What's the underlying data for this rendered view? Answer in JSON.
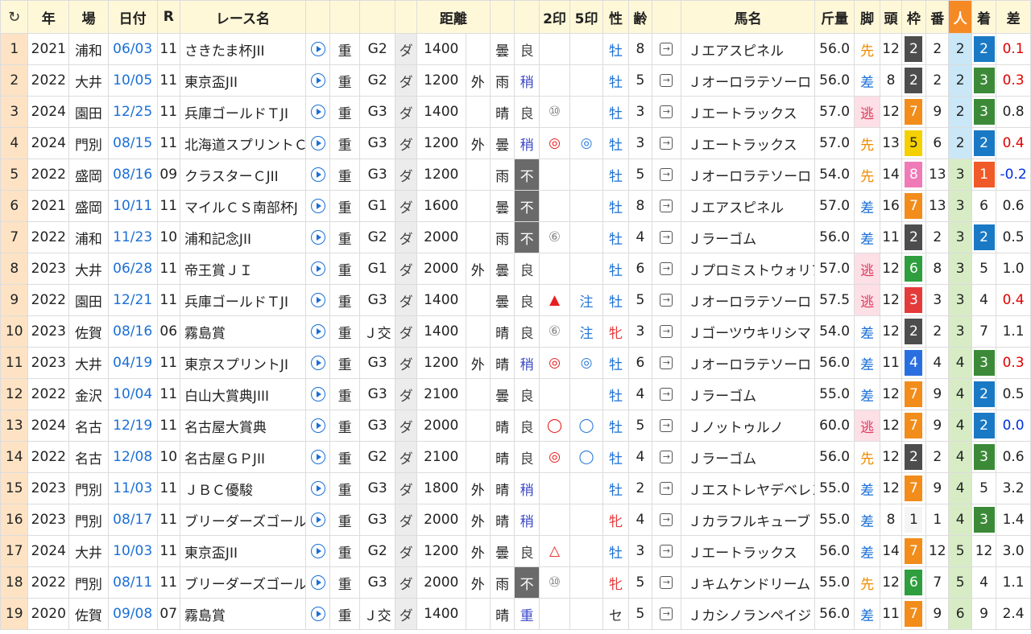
{
  "headers": {
    "refresh": "↻",
    "year": "年",
    "venue": "場",
    "date": "日付",
    "race_no": "R",
    "race": "レース名",
    "grade_blank": "",
    "dist": "距離",
    "m2": "2印",
    "m5": "5印",
    "sex": "性",
    "age": "齢",
    "horse": "馬名",
    "weight": "斤量",
    "style": "脚",
    "heads": "頭",
    "frame": "枠",
    "num": "番",
    "pop": "人",
    "rank": "着",
    "diff": "差"
  },
  "colors": {
    "frame_1": "#f5f5f5",
    "frame_2": "#4d4d4d",
    "frame_3": "#e53a3a",
    "frame_4": "#2a6fe0",
    "frame_5": "#f5d000",
    "frame_6": "#2e9e3e",
    "frame_7": "#f28c1a",
    "frame_8": "#f07ab8",
    "rank_1": "#f05a28",
    "rank_2": "#1a79c4",
    "rank_3": "#3c8a38",
    "pop_bg_low": "#c9e7f6",
    "pop_bg_high": "#d7ecc5"
  },
  "rows": [
    {
      "i": "1",
      "year": "2021",
      "venue": "浦和",
      "date": "06/03",
      "r": "11",
      "race": "さきたま杯JII",
      "track": "重",
      "grade": "G2",
      "surface": "ダ",
      "dist": "1400",
      "io": "",
      "weather": "曇",
      "cond": "良",
      "cond_t": "ok",
      "m2": "",
      "m2_t": "",
      "m5": "",
      "m5_t": "",
      "sex": "牡",
      "sex_t": "m",
      "age": "8",
      "horse": "Ｊエアスピネル",
      "weight": "56.0",
      "style": "先",
      "style_t": "senko",
      "heads": "12",
      "frame": "2",
      "num": "2",
      "pop": "2",
      "rank": "2",
      "diff": "0.1",
      "diff_t": "red"
    },
    {
      "i": "2",
      "year": "2022",
      "venue": "大井",
      "date": "10/05",
      "r": "11",
      "race": "東京盃JII",
      "track": "重",
      "grade": "G2",
      "surface": "ダ",
      "dist": "1200",
      "io": "外",
      "weather": "雨",
      "cond": "稍",
      "cond_t": "mid",
      "m2": "",
      "m2_t": "",
      "m5": "",
      "m5_t": "",
      "sex": "牡",
      "sex_t": "m",
      "age": "5",
      "horse": "Ｊオーロラテソーロ",
      "weight": "56.0",
      "style": "差",
      "style_t": "sashi",
      "heads": "8",
      "frame": "2",
      "num": "2",
      "pop": "2",
      "rank": "3",
      "diff": "0.3",
      "diff_t": "red"
    },
    {
      "i": "3",
      "year": "2024",
      "venue": "園田",
      "date": "12/25",
      "r": "11",
      "race": "兵庫ゴールドＴJI",
      "track": "重",
      "grade": "G3",
      "surface": "ダ",
      "dist": "1400",
      "io": "",
      "weather": "晴",
      "cond": "良",
      "cond_t": "ok",
      "m2": "⑩",
      "m2_t": "grey",
      "m5": "",
      "m5_t": "",
      "sex": "牡",
      "sex_t": "m",
      "age": "3",
      "horse": "Ｊエートラックス",
      "weight": "57.0",
      "style": "逃",
      "style_t": "nige",
      "heads": "12",
      "frame": "7",
      "num": "9",
      "pop": "2",
      "rank": "3",
      "diff": "0.8",
      "diff_t": "plain"
    },
    {
      "i": "4",
      "year": "2024",
      "venue": "門別",
      "date": "08/15",
      "r": "11",
      "race": "北海道スプリントＣ",
      "track": "重",
      "grade": "G3",
      "surface": "ダ",
      "dist": "1200",
      "io": "外",
      "weather": "曇",
      "cond": "稍",
      "cond_t": "mid",
      "m2": "◎",
      "m2_t": "red",
      "m5": "◎",
      "m5_t": "blue",
      "sex": "牡",
      "sex_t": "m",
      "age": "3",
      "horse": "Ｊエートラックス",
      "weight": "57.0",
      "style": "先",
      "style_t": "senko",
      "heads": "13",
      "frame": "5",
      "num": "6",
      "pop": "2",
      "rank": "2",
      "diff": "0.4",
      "diff_t": "red"
    },
    {
      "i": "5",
      "year": "2022",
      "venue": "盛岡",
      "date": "08/16",
      "r": "09",
      "race": "クラスターＣJII",
      "track": "重",
      "grade": "G3",
      "surface": "ダ",
      "dist": "1200",
      "io": "",
      "weather": "雨",
      "cond": "不",
      "cond_t": "bad",
      "m2": "",
      "m2_t": "",
      "m5": "",
      "m5_t": "",
      "sex": "牡",
      "sex_t": "m",
      "age": "5",
      "horse": "Ｊオーロラテソーロ",
      "weight": "54.0",
      "style": "先",
      "style_t": "senko",
      "heads": "14",
      "frame": "8",
      "num": "13",
      "pop": "3",
      "rank": "1",
      "diff": "-0.2",
      "diff_t": "blue"
    },
    {
      "i": "6",
      "year": "2021",
      "venue": "盛岡",
      "date": "10/11",
      "r": "11",
      "race": "マイルＣＳ南部杯J",
      "track": "重",
      "grade": "G1",
      "surface": "ダ",
      "dist": "1600",
      "io": "",
      "weather": "曇",
      "cond": "不",
      "cond_t": "bad",
      "m2": "",
      "m2_t": "",
      "m5": "",
      "m5_t": "",
      "sex": "牡",
      "sex_t": "m",
      "age": "8",
      "horse": "Ｊエアスピネル",
      "weight": "57.0",
      "style": "差",
      "style_t": "sashi",
      "heads": "16",
      "frame": "7",
      "num": "13",
      "pop": "3",
      "rank": "6",
      "diff": "0.6",
      "diff_t": "plain"
    },
    {
      "i": "7",
      "year": "2022",
      "venue": "浦和",
      "date": "11/23",
      "r": "10",
      "race": "浦和記念JII",
      "track": "重",
      "grade": "G2",
      "surface": "ダ",
      "dist": "2000",
      "io": "",
      "weather": "雨",
      "cond": "不",
      "cond_t": "bad",
      "m2": "⑥",
      "m2_t": "grey",
      "m5": "",
      "m5_t": "",
      "sex": "牡",
      "sex_t": "m",
      "age": "4",
      "horse": "Ｊラーゴム",
      "weight": "56.0",
      "style": "差",
      "style_t": "sashi",
      "heads": "11",
      "frame": "2",
      "num": "2",
      "pop": "3",
      "rank": "2",
      "diff": "0.5",
      "diff_t": "plain"
    },
    {
      "i": "8",
      "year": "2023",
      "venue": "大井",
      "date": "06/28",
      "r": "11",
      "race": "帝王賞ＪＩ",
      "track": "重",
      "grade": "G1",
      "surface": "ダ",
      "dist": "2000",
      "io": "外",
      "weather": "曇",
      "cond": "良",
      "cond_t": "ok",
      "m2": "",
      "m2_t": "",
      "m5": "",
      "m5_t": "",
      "sex": "牡",
      "sex_t": "m",
      "age": "6",
      "horse": "Ｊプロミストウォリア",
      "weight": "57.0",
      "style": "逃",
      "style_t": "nige",
      "heads": "12",
      "frame": "6",
      "num": "8",
      "pop": "3",
      "rank": "5",
      "diff": "1.0",
      "diff_t": "plain"
    },
    {
      "i": "9",
      "year": "2022",
      "venue": "園田",
      "date": "12/21",
      "r": "11",
      "race": "兵庫ゴールドＴJI",
      "track": "重",
      "grade": "G3",
      "surface": "ダ",
      "dist": "1400",
      "io": "",
      "weather": "曇",
      "cond": "良",
      "cond_t": "ok",
      "m2": "▲",
      "m2_t": "red",
      "m5": "注",
      "m5_t": "blue",
      "sex": "牡",
      "sex_t": "m",
      "age": "5",
      "horse": "Ｊオーロラテソーロ",
      "weight": "57.5",
      "style": "逃",
      "style_t": "nige",
      "heads": "12",
      "frame": "3",
      "num": "3",
      "pop": "3",
      "rank": "4",
      "diff": "0.4",
      "diff_t": "red"
    },
    {
      "i": "10",
      "year": "2023",
      "venue": "佐賀",
      "date": "08/16",
      "r": "06",
      "race": "霧島賞",
      "track": "重",
      "grade": "Ｊ交",
      "surface": "ダ",
      "dist": "1400",
      "io": "",
      "weather": "晴",
      "cond": "良",
      "cond_t": "ok",
      "m2": "⑥",
      "m2_t": "grey",
      "m5": "注",
      "m5_t": "blue",
      "sex": "牝",
      "sex_t": "f",
      "age": "3",
      "horse": "Ｊゴーツウキリシマ",
      "weight": "54.0",
      "style": "差",
      "style_t": "sashi",
      "heads": "12",
      "frame": "2",
      "num": "2",
      "pop": "3",
      "rank": "7",
      "diff": "1.1",
      "diff_t": "plain"
    },
    {
      "i": "11",
      "year": "2023",
      "venue": "大井",
      "date": "04/19",
      "r": "11",
      "race": "東京スプリントJI",
      "track": "重",
      "grade": "G3",
      "surface": "ダ",
      "dist": "1200",
      "io": "外",
      "weather": "晴",
      "cond": "稍",
      "cond_t": "mid",
      "m2": "◎",
      "m2_t": "red",
      "m5": "◎",
      "m5_t": "blue",
      "sex": "牡",
      "sex_t": "m",
      "age": "6",
      "horse": "Ｊオーロラテソーロ",
      "weight": "56.0",
      "style": "差",
      "style_t": "sashi",
      "heads": "11",
      "frame": "4",
      "num": "4",
      "pop": "4",
      "rank": "3",
      "diff": "0.3",
      "diff_t": "red"
    },
    {
      "i": "12",
      "year": "2022",
      "venue": "金沢",
      "date": "10/04",
      "r": "11",
      "race": "白山大賞典JIII",
      "track": "重",
      "grade": "G3",
      "surface": "ダ",
      "dist": "2100",
      "io": "",
      "weather": "曇",
      "cond": "良",
      "cond_t": "ok",
      "m2": "",
      "m2_t": "",
      "m5": "",
      "m5_t": "",
      "sex": "牡",
      "sex_t": "m",
      "age": "4",
      "horse": "Ｊラーゴム",
      "weight": "55.0",
      "style": "差",
      "style_t": "sashi",
      "heads": "12",
      "frame": "7",
      "num": "9",
      "pop": "4",
      "rank": "2",
      "diff": "0.5",
      "diff_t": "plain"
    },
    {
      "i": "13",
      "year": "2024",
      "venue": "名古",
      "date": "12/19",
      "r": "11",
      "race": "名古屋大賞典",
      "track": "重",
      "grade": "G3",
      "surface": "ダ",
      "dist": "2000",
      "io": "",
      "weather": "晴",
      "cond": "良",
      "cond_t": "ok",
      "m2": "◯",
      "m2_t": "red",
      "m5": "◯",
      "m5_t": "blue",
      "sex": "牡",
      "sex_t": "m",
      "age": "5",
      "horse": "Ｊノットゥルノ",
      "weight": "60.0",
      "style": "逃",
      "style_t": "nige",
      "heads": "12",
      "frame": "7",
      "num": "9",
      "pop": "4",
      "rank": "2",
      "diff": "0.0",
      "diff_t": "blue"
    },
    {
      "i": "14",
      "year": "2022",
      "venue": "名古",
      "date": "12/08",
      "r": "10",
      "race": "名古屋ＧＰJII",
      "track": "重",
      "grade": "G2",
      "surface": "ダ",
      "dist": "2100",
      "io": "",
      "weather": "晴",
      "cond": "良",
      "cond_t": "ok",
      "m2": "◎",
      "m2_t": "red",
      "m5": "◯",
      "m5_t": "blue",
      "sex": "牡",
      "sex_t": "m",
      "age": "4",
      "horse": "Ｊラーゴム",
      "weight": "56.0",
      "style": "先",
      "style_t": "senko",
      "heads": "12",
      "frame": "2",
      "num": "2",
      "pop": "4",
      "rank": "3",
      "diff": "0.6",
      "diff_t": "plain"
    },
    {
      "i": "15",
      "year": "2023",
      "venue": "門別",
      "date": "11/03",
      "r": "11",
      "race": "ＪＢＣ優駿",
      "track": "重",
      "grade": "G3",
      "surface": "ダ",
      "dist": "1800",
      "io": "外",
      "weather": "晴",
      "cond": "稍",
      "cond_t": "mid",
      "m2": "",
      "m2_t": "",
      "m5": "",
      "m5_t": "",
      "sex": "牡",
      "sex_t": "m",
      "age": "2",
      "horse": "Ｊエストレヤデベレン",
      "weight": "55.0",
      "style": "差",
      "style_t": "sashi",
      "heads": "12",
      "frame": "7",
      "num": "9",
      "pop": "4",
      "rank": "5",
      "diff": "3.2",
      "diff_t": "plain"
    },
    {
      "i": "16",
      "year": "2023",
      "venue": "門別",
      "date": "08/17",
      "r": "11",
      "race": "ブリーダーズゴール",
      "track": "重",
      "grade": "G3",
      "surface": "ダ",
      "dist": "2000",
      "io": "外",
      "weather": "晴",
      "cond": "稍",
      "cond_t": "mid",
      "m2": "",
      "m2_t": "",
      "m5": "",
      "m5_t": "",
      "sex": "牝",
      "sex_t": "f",
      "age": "4",
      "horse": "Ｊカラフルキューブ",
      "weight": "55.0",
      "style": "差",
      "style_t": "sashi",
      "heads": "8",
      "frame": "1",
      "num": "1",
      "pop": "4",
      "rank": "3",
      "diff": "1.4",
      "diff_t": "plain"
    },
    {
      "i": "17",
      "year": "2024",
      "venue": "大井",
      "date": "10/03",
      "r": "11",
      "race": "東京盃JII",
      "track": "重",
      "grade": "G2",
      "surface": "ダ",
      "dist": "1200",
      "io": "外",
      "weather": "曇",
      "cond": "良",
      "cond_t": "ok",
      "m2": "△",
      "m2_t": "red",
      "m5": "",
      "m5_t": "",
      "sex": "牡",
      "sex_t": "m",
      "age": "3",
      "horse": "Ｊエートラックス",
      "weight": "56.0",
      "style": "差",
      "style_t": "sashi",
      "heads": "14",
      "frame": "7",
      "num": "12",
      "pop": "5",
      "rank": "12",
      "diff": "3.0",
      "diff_t": "plain"
    },
    {
      "i": "18",
      "year": "2022",
      "venue": "門別",
      "date": "08/11",
      "r": "11",
      "race": "ブリーダーズゴール",
      "track": "重",
      "grade": "G3",
      "surface": "ダ",
      "dist": "2000",
      "io": "外",
      "weather": "雨",
      "cond": "不",
      "cond_t": "bad",
      "m2": "⑩",
      "m2_t": "grey",
      "m5": "",
      "m5_t": "",
      "sex": "牝",
      "sex_t": "f",
      "age": "5",
      "horse": "Ｊキムケンドリーム",
      "weight": "55.0",
      "style": "先",
      "style_t": "senko",
      "heads": "12",
      "frame": "6",
      "num": "7",
      "pop": "5",
      "rank": "4",
      "diff": "1.1",
      "diff_t": "plain"
    },
    {
      "i": "19",
      "year": "2020",
      "venue": "佐賀",
      "date": "09/08",
      "r": "07",
      "race": "霧島賞",
      "track": "重",
      "grade": "Ｊ交",
      "surface": "ダ",
      "dist": "1400",
      "io": "",
      "weather": "晴",
      "cond": "重",
      "cond_t": "mid",
      "m2": "",
      "m2_t": "",
      "m5": "",
      "m5_t": "",
      "sex": "セ",
      "sex_t": "g",
      "age": "5",
      "horse": "Ｊカシノランペイジ",
      "weight": "56.0",
      "style": "差",
      "style_t": "sashi",
      "heads": "11",
      "frame": "7",
      "num": "9",
      "pop": "6",
      "rank": "9",
      "diff": "2.4",
      "diff_t": "plain"
    }
  ]
}
